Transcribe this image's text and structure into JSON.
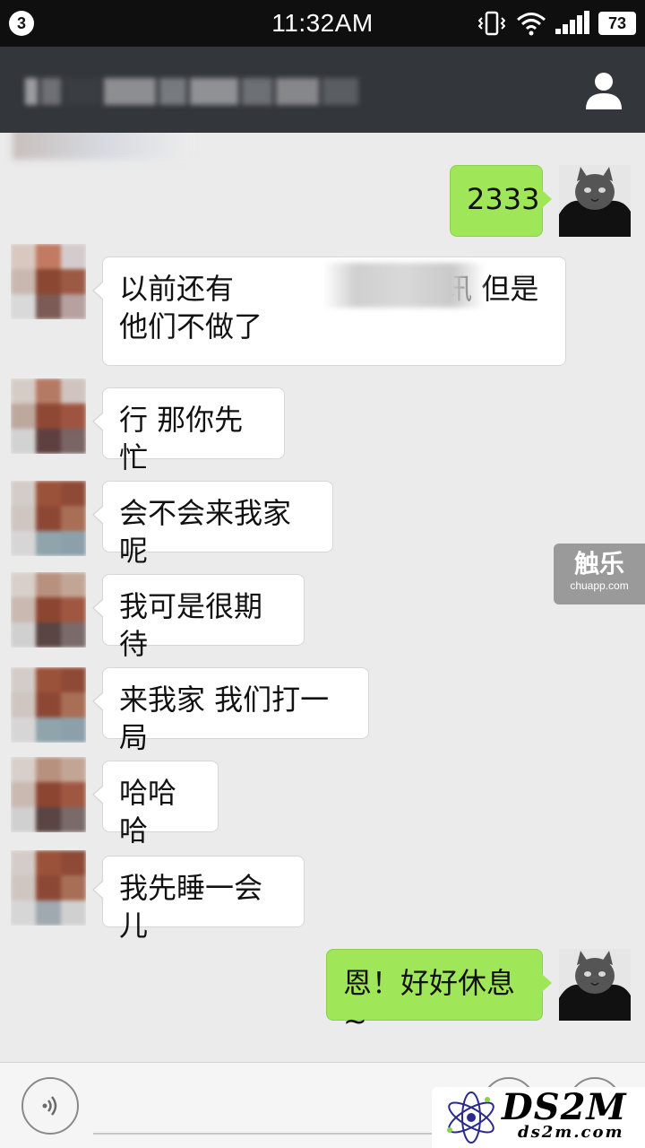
{
  "status_bar": {
    "notification_count": "3",
    "time": "11:32AM",
    "battery": "73",
    "icons": [
      "vibrate-icon",
      "wifi-icon",
      "signal-icon",
      "battery-icon"
    ]
  },
  "header": {
    "contact_name": "",
    "right_icon": "person-icon",
    "background": "#33363b"
  },
  "messages": [
    {
      "side": "right",
      "text": "2333"
    },
    {
      "side": "left",
      "text": "以前还有　　　　　　　 讯 但是他们不做了"
    },
    {
      "side": "left",
      "text": "行 那你先忙"
    },
    {
      "side": "left",
      "text": "会不会来我家呢"
    },
    {
      "side": "left",
      "text": "我可是很期待"
    },
    {
      "side": "left",
      "text": "来我家 我们打一局"
    },
    {
      "side": "left",
      "text": "哈哈哈"
    },
    {
      "side": "left",
      "text": "我先睡一会儿"
    },
    {
      "side": "right",
      "text": "恩！好好休息~"
    }
  ],
  "watermark": {
    "main": "触乐",
    "sub": "chuapp.com"
  },
  "input_bar": {
    "icons": [
      "voice-icon",
      "emoji-icon",
      "more-icon"
    ]
  },
  "badge": {
    "main": "DS2M",
    "sub": "ds2m.com"
  },
  "colors": {
    "chat_background": "#ebebeb",
    "sent_bubble": "#9fe658",
    "received_bubble": "#ffffff"
  }
}
